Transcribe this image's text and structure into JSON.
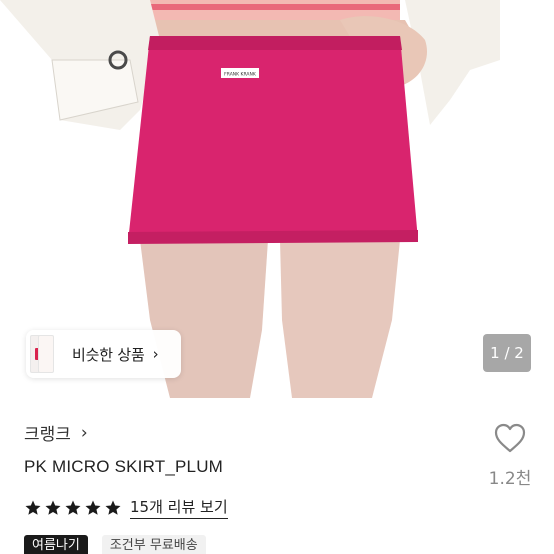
{
  "hero": {
    "similar_label": "비슷한 상품",
    "similar_chevron": "›",
    "pager_text": "1 / 2",
    "skirt_label_text": "FRANK KRANK"
  },
  "product": {
    "store_name": "크랭크",
    "store_chevron": "›",
    "title": "PK MICRO SKIRT_PLUM",
    "rating": 5,
    "review_link": "15개 리뷰 보기",
    "like_count": "1.2천",
    "tags": [
      "여름나기",
      "조건부 무료배송"
    ]
  },
  "colors": {
    "skirt": "#d9246e",
    "star": "#1a1a1a",
    "heart_stroke": "#8a8a8a"
  },
  "icons": {
    "star": "star-icon",
    "heart": "heart-icon",
    "chevron": "chevron-right-icon"
  }
}
